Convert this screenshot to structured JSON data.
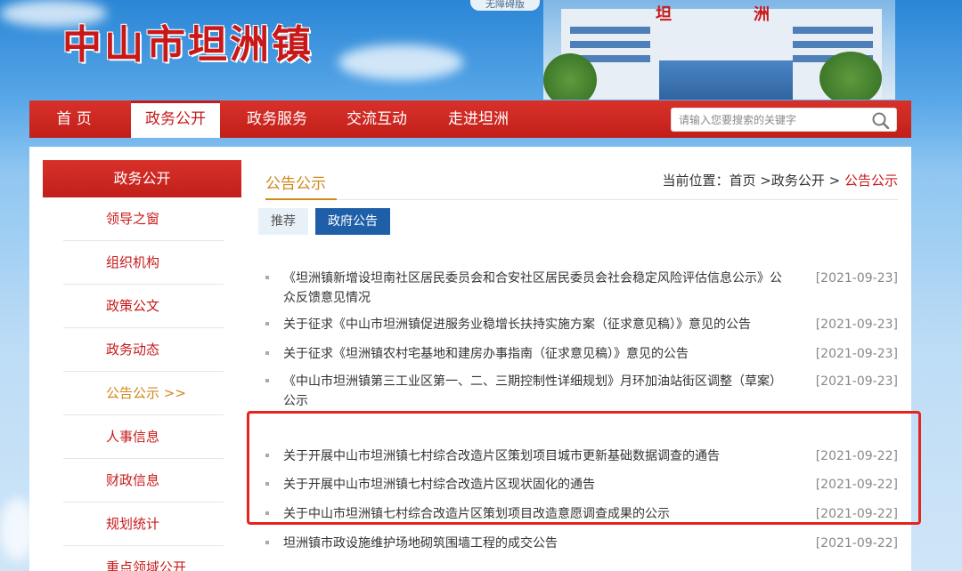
{
  "banner": {
    "site_title": "中山市坦洲镇",
    "access_badge": "无障碍版",
    "building_sign_left": "坦",
    "building_sign_right": "洲"
  },
  "nav": {
    "items": [
      {
        "label": "首  页"
      },
      {
        "label": "政务公开"
      },
      {
        "label": "政务服务"
      },
      {
        "label": "交流互动"
      },
      {
        "label": "走进坦洲"
      }
    ],
    "active_index": 1,
    "search_placeholder": "请输入您要搜索的关键字"
  },
  "sidebar": {
    "heading": "政务公开",
    "items": [
      {
        "label": "领导之窗"
      },
      {
        "label": "组织机构"
      },
      {
        "label": "政策公文"
      },
      {
        "label": "政务动态"
      },
      {
        "label": "公告公示 >>"
      },
      {
        "label": "人事信息"
      },
      {
        "label": "财政信息"
      },
      {
        "label": "规划统计"
      },
      {
        "label": "重点领域公开"
      }
    ],
    "active_index": 4
  },
  "main": {
    "title": "公告公示",
    "breadcrumb": {
      "prefix": "当前位置：",
      "home": "首页",
      "sep1": " >",
      "section": "政务公开",
      "sep2": " > ",
      "current": "公告公示"
    },
    "tabs": [
      {
        "label": "推荐"
      },
      {
        "label": "政府公告"
      }
    ],
    "selected_tab": 1,
    "notices": [
      {
        "title": "《坦洲镇新增设坦南社区居民委员会和合安社区居民委员会社会稳定风险评估信息公示》公众反馈意见情况",
        "date": "[2021-09-23]"
      },
      {
        "title": "关于征求《中山市坦洲镇促进服务业稳增长扶持实施方案（征求意见稿）》意见的公告",
        "date": "[2021-09-23]"
      },
      {
        "title": "关于征求《坦洲镇农村宅基地和建房办事指南（征求意见稿）》意见的公告",
        "date": "[2021-09-23]"
      },
      {
        "title": "《中山市坦洲镇第三工业区第一、二、三期控制性详细规划》月环加油站街区调整（草案）公示",
        "date": "[2021-09-23]"
      },
      {
        "title": "关于开展中山市坦洲镇七村综合改造片区策划项目城市更新基础数据调查的通告",
        "date": "[2021-09-22]"
      },
      {
        "title": "关于开展中山市坦洲镇七村综合改造片区现状固化的通告",
        "date": "[2021-09-22]"
      },
      {
        "title": "关于中山市坦洲镇七村综合改造片区策划项目改造意愿调查成果的公示",
        "date": "[2021-09-22]"
      },
      {
        "title": "坦洲镇市政设施维护场地砌筑围墙工程的成交公告",
        "date": "[2021-09-22]"
      }
    ]
  },
  "colors": {
    "brand_red": "#c8191a",
    "accent_orange": "#d0891c",
    "tab_blue": "#1f5fa8",
    "highlight_red": "#e6231d"
  }
}
